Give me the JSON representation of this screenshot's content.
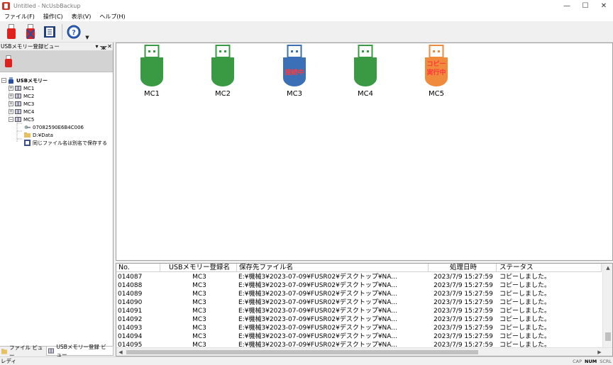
{
  "window": {
    "title": "Untitled - NcUsbBackup",
    "minimize": "—",
    "maximize": "☐",
    "close": "✕"
  },
  "menu": [
    "ファイル(F)",
    "操作(C)",
    "表示(V)",
    "ヘルプ(H)"
  ],
  "colors": {
    "usb_idle": "#3a9a44",
    "usb_connected": "#3b6fb6",
    "usb_copying": "#f08a3c",
    "usb_badge_text": "#ff3a3a",
    "accent_red": "#e0201c"
  },
  "left_pane": {
    "title": "USBメモリー登録ビュー",
    "pin_icon": "pin-icon",
    "tree": {
      "root": "USBメモリー",
      "items": [
        "MC1",
        "MC2",
        "MC3",
        "MC4",
        "MC5"
      ],
      "mc5_children": [
        "07082590E6B4C006",
        "D:¥Data",
        "同じファイル名は別名で保存する"
      ]
    }
  },
  "left_tabs": [
    "ファイル ビュー",
    "USBメモリー登録 ビュー"
  ],
  "devices": [
    {
      "label": "MC1",
      "state": "idle",
      "badge": ""
    },
    {
      "label": "MC2",
      "state": "idle",
      "badge": ""
    },
    {
      "label": "MC3",
      "state": "connected",
      "badge": "接続中"
    },
    {
      "label": "MC4",
      "state": "idle",
      "badge": ""
    },
    {
      "label": "MC5",
      "state": "copying",
      "badge_line1": "コピー",
      "badge_line2": "実行中"
    }
  ],
  "log_table": {
    "columns": [
      "No.",
      "USBメモリー登録名",
      "保存先ファイル名",
      "処理日時",
      "ステータス"
    ],
    "rows": [
      [
        "014087",
        "MC3",
        "E:¥機械3¥2023-07-09¥FUSR02¥デスクトップ¥NA...",
        "2023/7/9 15:27:59",
        "コピーしました。"
      ],
      [
        "014088",
        "MC3",
        "E:¥機械3¥2023-07-09¥FUSR02¥デスクトップ¥NA...",
        "2023/7/9 15:27:59",
        "コピーしました。"
      ],
      [
        "014089",
        "MC3",
        "E:¥機械3¥2023-07-09¥FUSR02¥デスクトップ¥NA...",
        "2023/7/9 15:27:59",
        "コピーしました。"
      ],
      [
        "014090",
        "MC3",
        "E:¥機械3¥2023-07-09¥FUSR02¥デスクトップ¥NA...",
        "2023/7/9 15:27:59",
        "コピーしました。"
      ],
      [
        "014091",
        "MC3",
        "E:¥機械3¥2023-07-09¥FUSR02¥デスクトップ¥NA...",
        "2023/7/9 15:27:59",
        "コピーしました。"
      ],
      [
        "014092",
        "MC3",
        "E:¥機械3¥2023-07-09¥FUSR02¥デスクトップ¥NA...",
        "2023/7/9 15:27:59",
        "コピーしました。"
      ],
      [
        "014093",
        "MC3",
        "E:¥機械3¥2023-07-09¥FUSR02¥デスクトップ¥NA...",
        "2023/7/9 15:27:59",
        "コピーしました。"
      ],
      [
        "014094",
        "MC3",
        "E:¥機械3¥2023-07-09¥FUSR02¥デスクトップ¥NA...",
        "2023/7/9 15:27:59",
        "コピーしました。"
      ],
      [
        "014095",
        "MC3",
        "E:¥機械3¥2023-07-09¥FUSR02¥デスクトップ¥NA...",
        "2023/7/9 15:27:59",
        "コピーしました。"
      ]
    ]
  },
  "status": {
    "text": "レディ",
    "indicators": [
      {
        "label": "CAP",
        "on": false
      },
      {
        "label": "NUM",
        "on": true
      },
      {
        "label": "SCRL",
        "on": false
      }
    ]
  }
}
